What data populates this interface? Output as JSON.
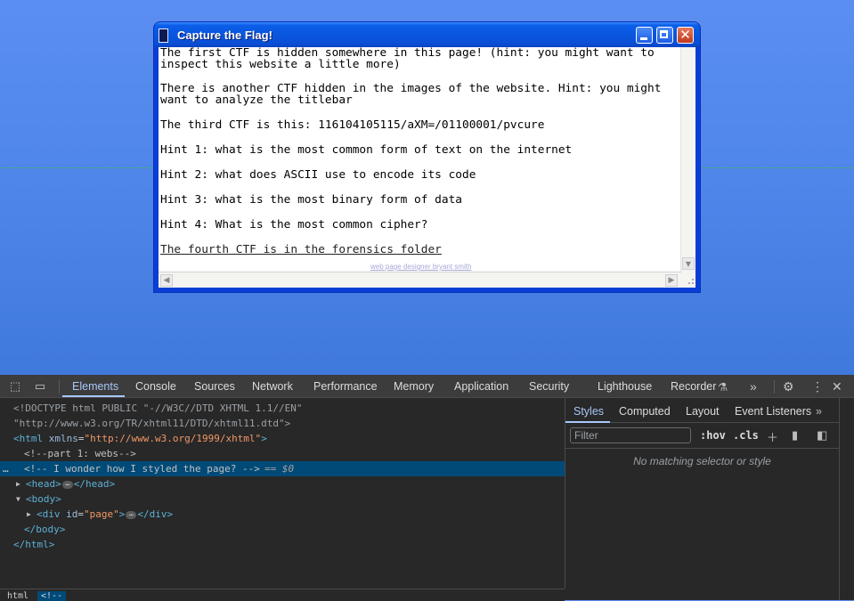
{
  "window": {
    "title": "Capture the Flag!",
    "close_glyph": "✕",
    "lines": [
      "The first CTF is hidden somewhere in this page! (hint: you might want to inspect this website a little more)",
      "There is another CTF hidden in the images of the website. Hint: you might want to analyze the titlebar",
      "The third CTF is this: 116104105115/aXM=/01100001/pvcure",
      "Hint 1: what is the most common form of text on the internet",
      "Hint 2: what does ASCII use to encode its code",
      "Hint 3: what is the most binary form of data",
      "Hint 4: What is the most common cipher?"
    ],
    "link": "The fourth CTF is in the forensics folder",
    "designer": "web page designer bryant smith"
  },
  "devtools": {
    "tabs": [
      "Elements",
      "Console",
      "Sources",
      "Network",
      "Performance",
      "Memory",
      "Application",
      "Security",
      "Lighthouse",
      "Recorder"
    ],
    "more_tabs": "»",
    "dom": {
      "doctype_1": "<!DOCTYPE html PUBLIC \"-//W3C//DTD XHTML 1.1//EN\"",
      "doctype_2": "\"http://www.w3.org/TR/xhtml11/DTD/xhtml11.dtd\">",
      "html_open_tag": "<html",
      "html_attr": "xmlns",
      "html_val": "\"http://www.w3.org/1999/xhtml\"",
      "comment_1": "<!--part 1: webs-->",
      "comment_2": "<!-- I wonder how I styled the page? -->",
      "selected_ref": "== $0",
      "head_open": "<head>",
      "head_close": "</head>",
      "body_open": "<body>",
      "div_open": "<div",
      "div_attr": "id",
      "div_val": "\"page\"",
      "div_close": "</div>",
      "body_close": "</body>",
      "html_close": "</html>",
      "ellipsis": "…"
    },
    "breadcrumbs": [
      "html",
      "<!--"
    ],
    "styles": {
      "tabs": [
        "Styles",
        "Computed",
        "Layout",
        "Event Listeners"
      ],
      "filter_placeholder": "Filter",
      "hov": ":hov",
      "cls": ".cls",
      "no_match": "No matching selector or style"
    }
  }
}
